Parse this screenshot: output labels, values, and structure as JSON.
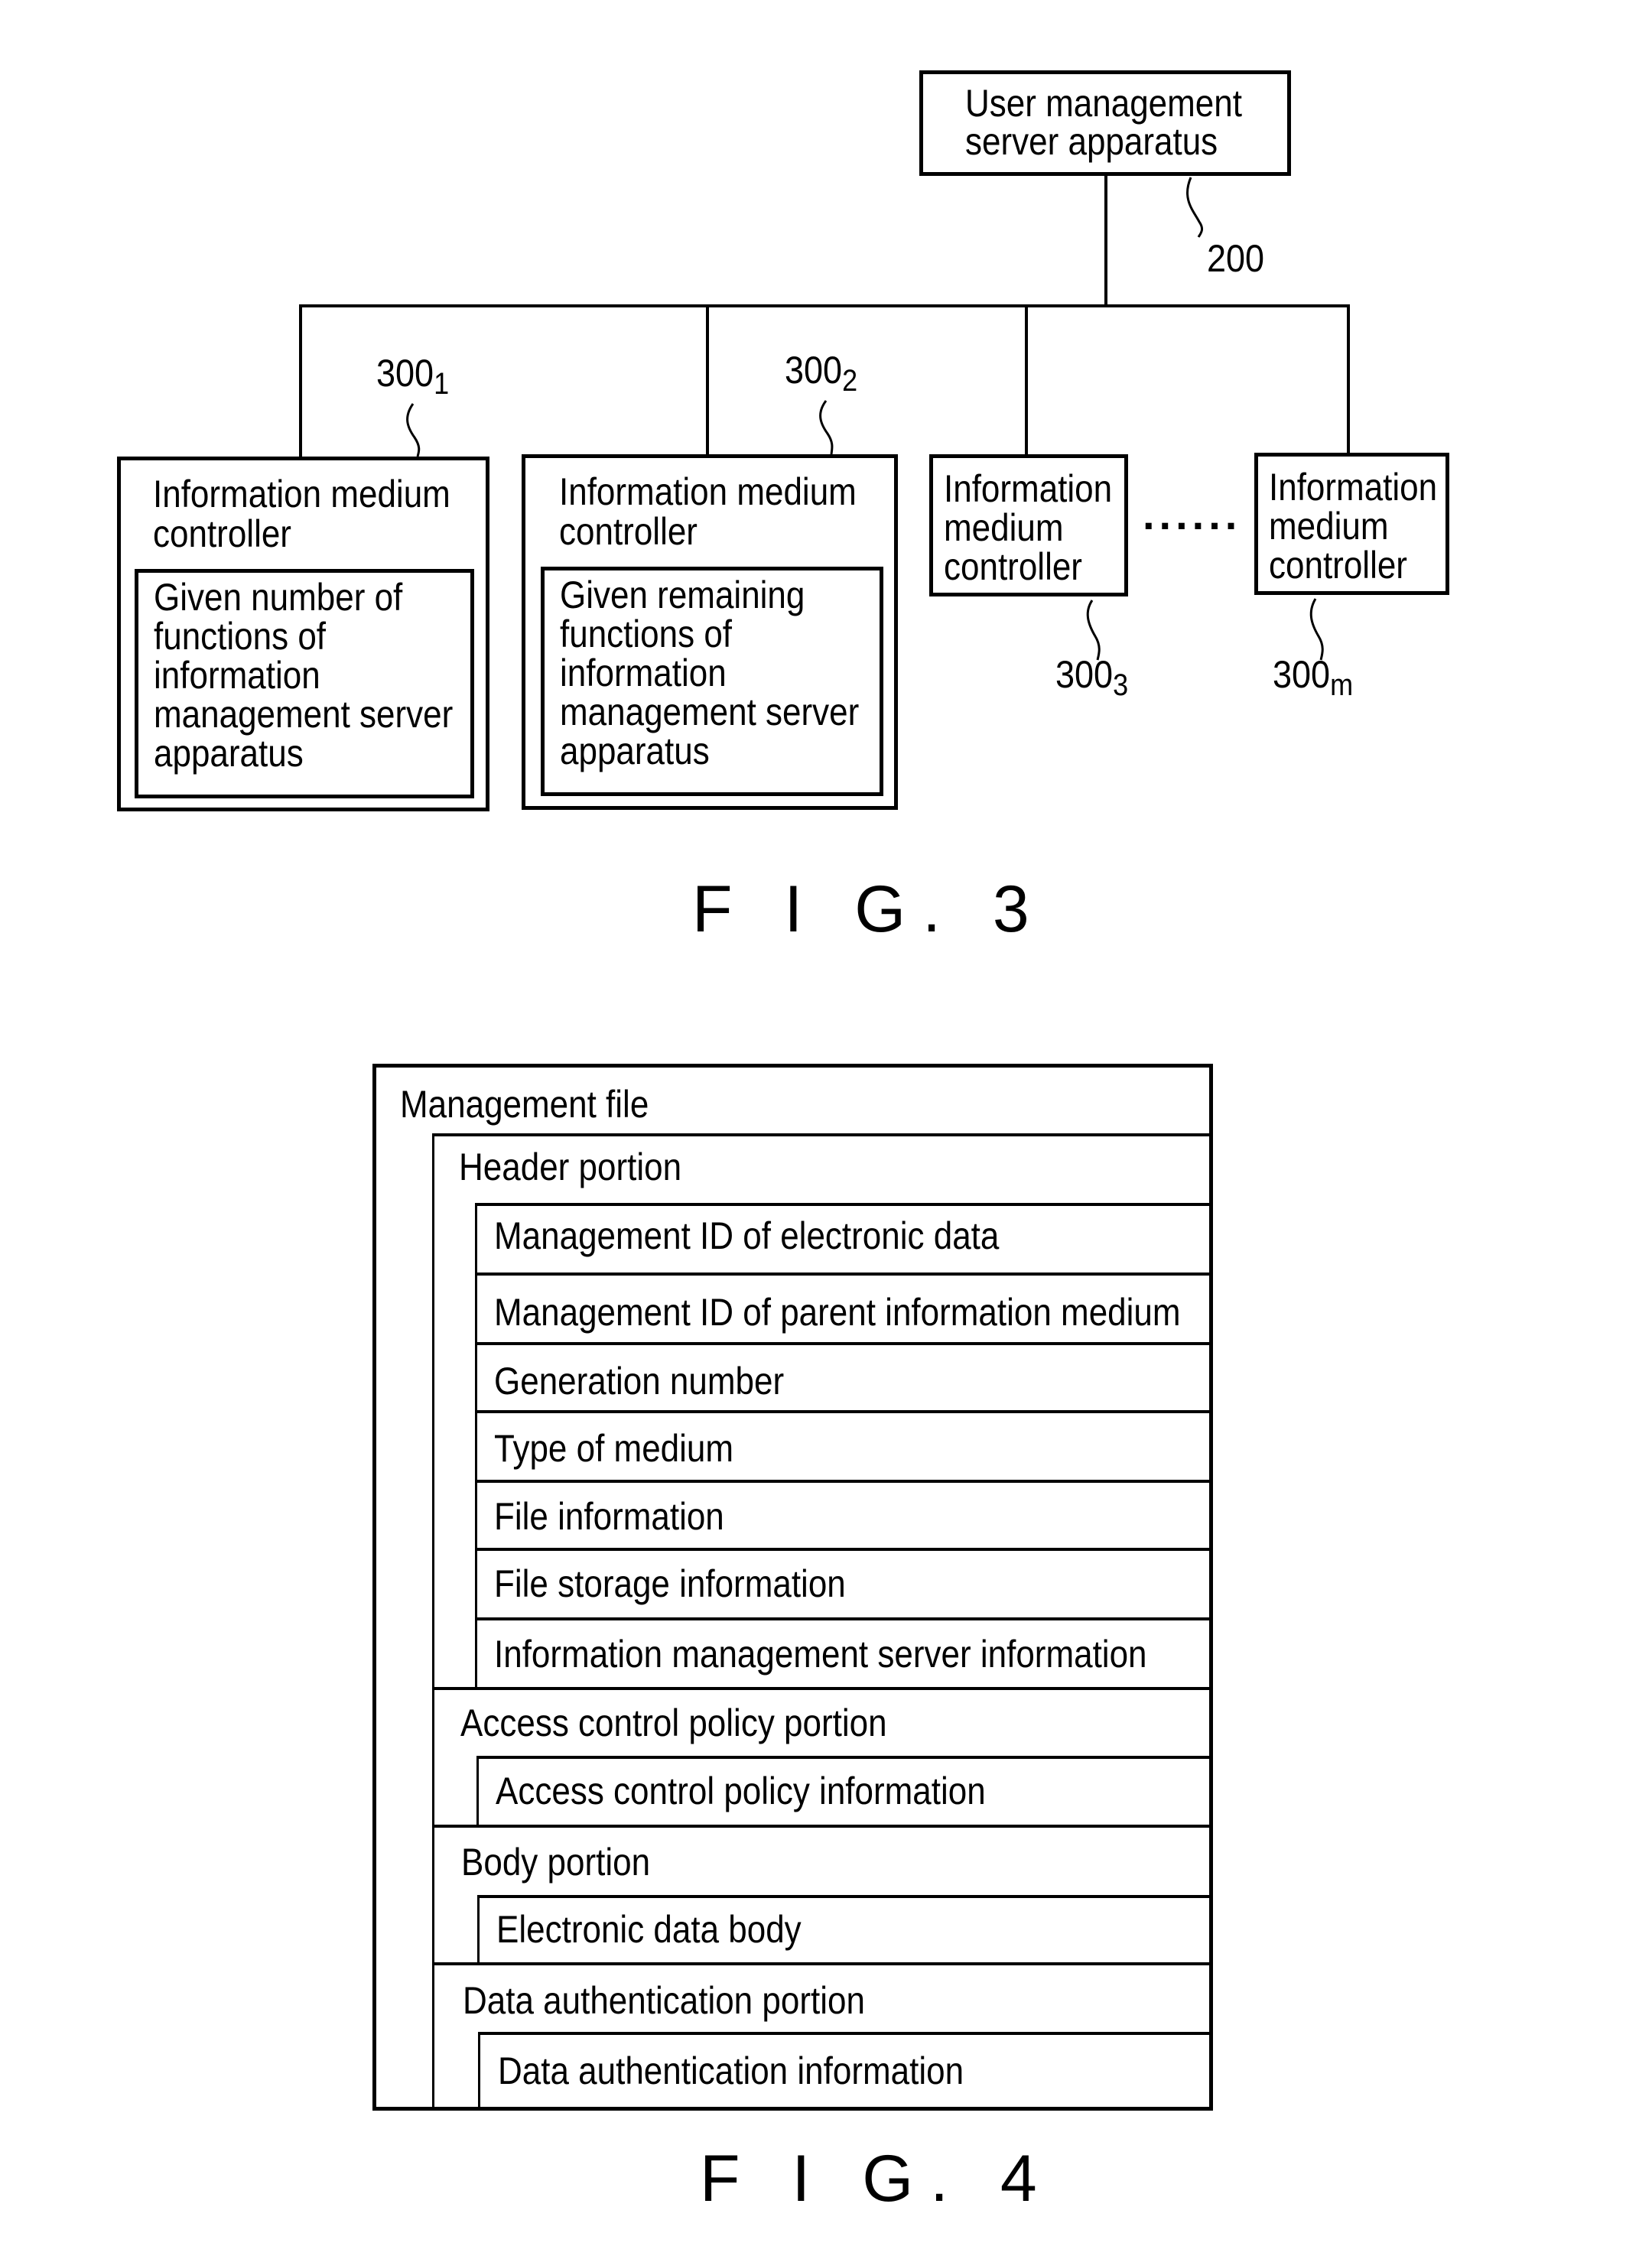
{
  "fig3": {
    "caption": "F I G. 3",
    "user_server": {
      "label_lines": [
        "User management",
        "server apparatus"
      ],
      "ref": "200"
    },
    "controllers": [
      {
        "title_lines": [
          "Information medium",
          "controller"
        ],
        "inner_lines": [
          "Given number of",
          "functions of",
          "information",
          "management server",
          "apparatus"
        ],
        "ref_main": "300",
        "ref_sub": "1"
      },
      {
        "title_lines": [
          "Information medium",
          "controller"
        ],
        "inner_lines": [
          "Given remaining",
          "functions of",
          "information",
          "management server",
          "apparatus"
        ],
        "ref_main": "300",
        "ref_sub": "2"
      },
      {
        "title_lines": [
          "Information",
          "medium",
          "controller"
        ],
        "ref_main": "300",
        "ref_sub": "3"
      },
      {
        "title_lines": [
          "Information",
          "medium",
          "controller"
        ],
        "ref_main": "300",
        "ref_sub": "m"
      }
    ],
    "ellipsis": "......"
  },
  "fig4": {
    "caption": "F I G. 4",
    "title": "Management file",
    "sections": [
      {
        "label": "Header portion",
        "items": [
          "Management ID of electronic data",
          "Management ID of parent information medium",
          "Generation number",
          "Type of medium",
          "File information",
          "File storage information",
          "Information management server information"
        ]
      },
      {
        "label": "Access control policy portion",
        "items": [
          "Access control policy information"
        ]
      },
      {
        "label": "Body portion",
        "items": [
          "Electronic data body"
        ]
      },
      {
        "label": "Data authentication portion",
        "items": [
          "Data authentication information"
        ]
      }
    ]
  }
}
